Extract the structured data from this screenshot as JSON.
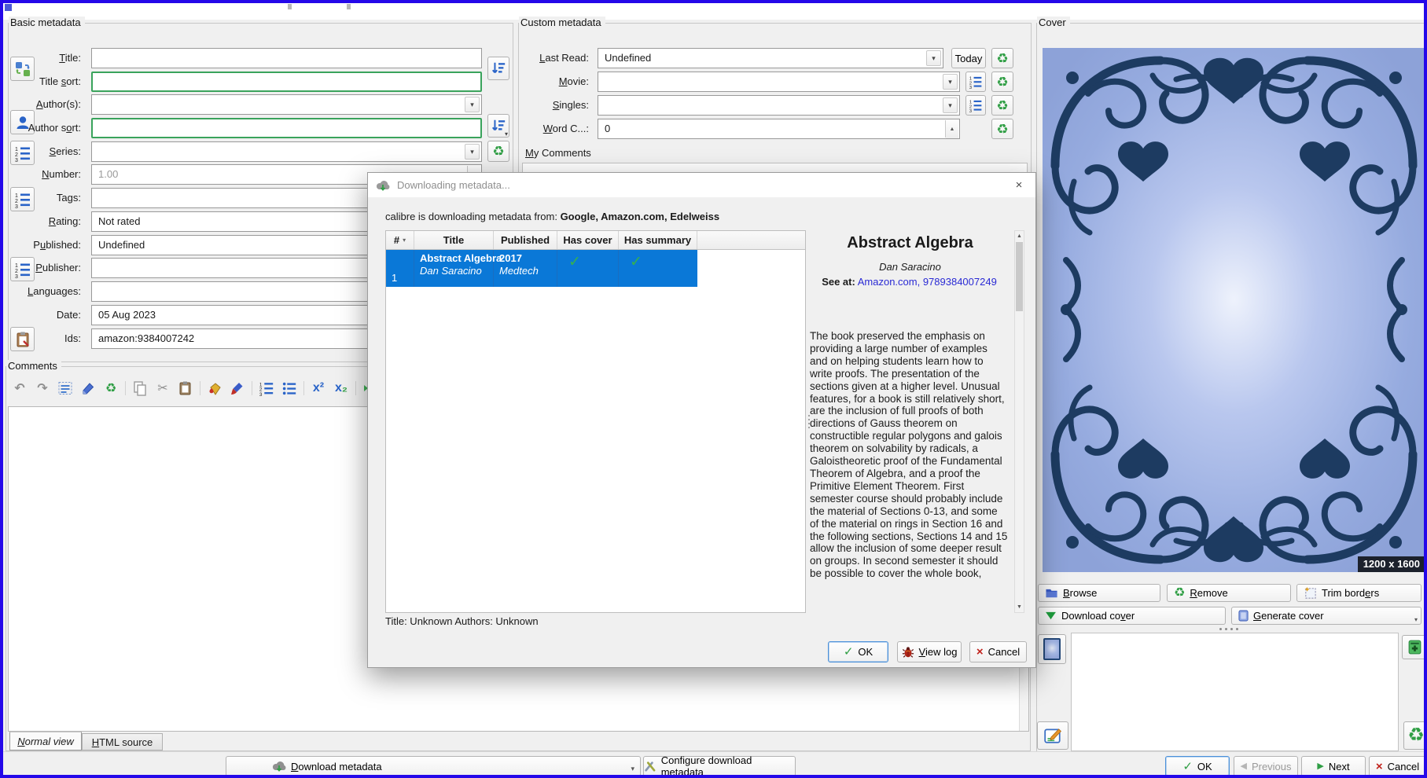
{
  "icons": {
    "checkmark": "✓",
    "recycle": "♻",
    "dropdown": "▾",
    "sort_indicator": "▾",
    "close": "×",
    "ok_check": "✓",
    "cancel_x": "×",
    "prev_chevron": "◀",
    "next_chevron": "▶",
    "undo": "↶",
    "redo": "↷",
    "cut": "✂",
    "scroll_up": "▲",
    "scroll_down": "▼",
    "spin_up": "▲",
    "spin_down": "▼",
    "sup_x": "x",
    "sup_2": "²",
    "sub_x": "x",
    "sub_2": "₂",
    "table_check": "✓",
    "author_sort_menu": "▾"
  },
  "basic": {
    "group_label": "Basic metadata",
    "title_label": "_T_itle:",
    "title_value": "",
    "title_sort_label": "Title _s_ort:",
    "title_sort_value": "",
    "authors_label": "_A_uthor(s):",
    "authors_value": "",
    "author_sort_label": "Author s_o_rt:",
    "author_sort_value": "",
    "series_label": "_S_eries:",
    "series_value": "",
    "number_label": "_N_umber:",
    "number_value": "1.00",
    "tags_label": "Ta_g_s:",
    "tags_value": "",
    "rating_label": "_R_ating:",
    "rating_value": "Not rated",
    "published_label": "P_u_blished:",
    "published_value": "Undefined",
    "publisher_label": "_P_ublisher:",
    "publisher_value": "",
    "languages_label": "_L_anguages:",
    "languages_value": "",
    "date_label": "Date:",
    "date_value": "05 Aug 2023",
    "ids_label": "Ids:",
    "ids_value": "amazon:9384007242"
  },
  "custom": {
    "group_label": "Custom metadata",
    "last_read_label": "_L_ast Read:",
    "last_read_value": "Undefined",
    "today_button": "Today",
    "movie_label": "_M_ovie:",
    "movie_value": "",
    "singles_label": "_S_ingles:",
    "singles_value": "",
    "word_count_label": "_W_ord C...:",
    "word_count_value": "0",
    "my_comments_label": "_M_y Comments"
  },
  "cover": {
    "group_label": "Cover",
    "size_badge": "1200 x 1600",
    "browse_button": "_B_rowse",
    "remove_button": "_R_emove",
    "trim_button": "Trim bord_e_rs",
    "download_button": "Download co_v_er",
    "generate_button": "_G_enerate cover"
  },
  "comments": {
    "group_label": "Comments",
    "tab_normal": "_N_ormal view",
    "tab_html": "_H_TML source"
  },
  "dialog": {
    "title": "Downloading metadata...",
    "source_prefix": "calibre is downloading metadata from: ",
    "sources": "Google, Amazon.com, Edelweiss",
    "table": {
      "headers": [
        "#",
        "Title",
        "Published",
        "Has cover",
        "Has summary"
      ],
      "rows": [
        {
          "num": "1",
          "title": "Abstract Algebra",
          "author": "Dan Saracino",
          "published": "2017",
          "publisher": "Medtech",
          "has_cover": "yes",
          "has_summary": "yes"
        }
      ]
    },
    "details": {
      "title": "Abstract Algebra",
      "author": "Dan Saracino",
      "see_at_label": "See at:",
      "see_at_links": "Amazon.com, 9789384007249",
      "description": "The book preserved the emphasis on providing a large number of examples and on helping students learn how to write proofs. The presentation of the sections given at a higher level. Unusual features, for a book is still relatively short, are the inclusion of full proofs of both directions of Gauss theorem on constructible regular polygons and galois theorem on solvability by radicals, a Galoistheoretic proof of the Fundamental Theorem of Algebra, and a proof the Primitive Element Theorem. First semester course should probably include the material of Sections 0-13, and some of the material on rings in Section 16 and the following sections, Sections 14 and 15 allow the inclusion of some deeper result on groups. In second semester it should be possible to cover the whole book,"
    },
    "status": "Title: Unknown Authors: Unknown",
    "ok_button": "OK",
    "view_log_button": "_V_iew log",
    "cancel_button": "Cancel"
  },
  "bottom_bar": {
    "download_metadata_button": "_D_ownload metadata",
    "configure_button": "Configure download metadata",
    "ok_button": "OK",
    "previous_button": "Previous",
    "next_button": "Next",
    "cancel_button": "Cancel"
  },
  "colors": {
    "selection_blue": "#0a78d7",
    "valid_green": "#3aa35c",
    "link_blue": "#2a2ad4",
    "window_border": "#2408e9",
    "cover_navy": "#1d3b61",
    "cover_blue": "#96abdf"
  }
}
